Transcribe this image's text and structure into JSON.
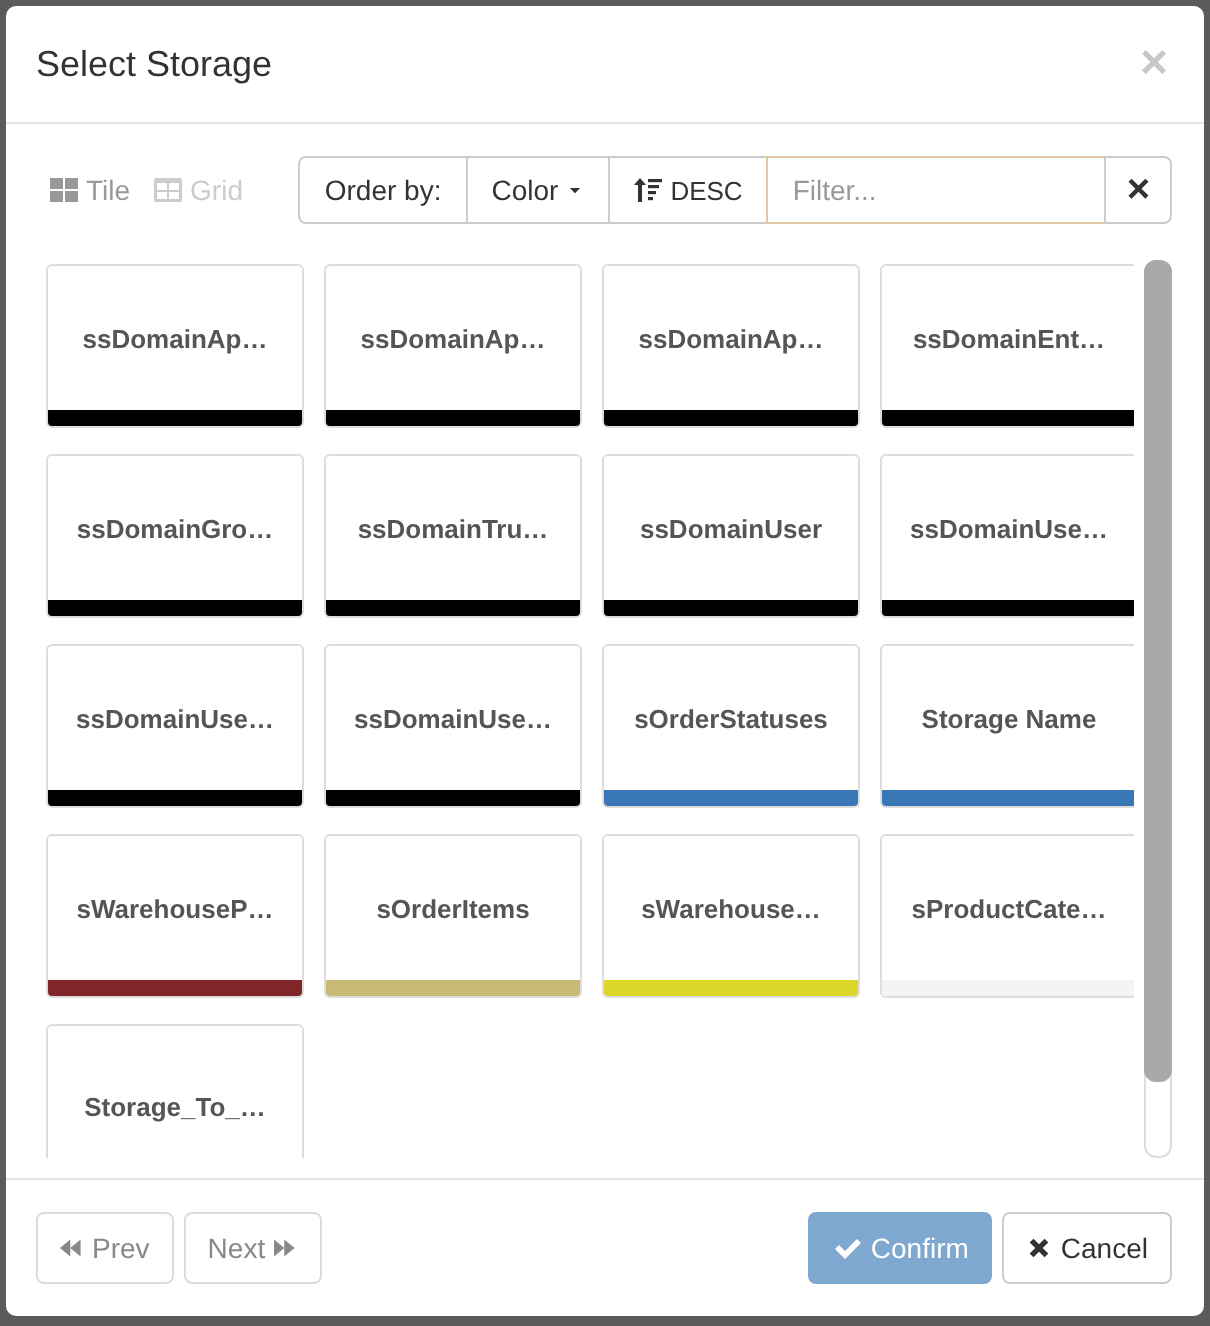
{
  "dialog": {
    "title": "Select Storage",
    "close": "×"
  },
  "toolbar": {
    "views": [
      {
        "label": "Tile",
        "selected": true
      },
      {
        "label": "Grid",
        "selected": false
      }
    ],
    "order_label": "Order by:",
    "order_field": "Color",
    "sort_direction": "DESC",
    "filter": {
      "placeholder": "Filter..."
    },
    "clear": "×"
  },
  "tiles": [
    {
      "name": "ssDomainAp…",
      "color": "#000000"
    },
    {
      "name": "ssDomainAp…",
      "color": "#000000"
    },
    {
      "name": "ssDomainAp…",
      "color": "#000000"
    },
    {
      "name": "ssDomainEnt…",
      "color": "#000000"
    },
    {
      "name": "ssDomainGro…",
      "color": "#000000"
    },
    {
      "name": "ssDomainTru…",
      "color": "#000000"
    },
    {
      "name": "ssDomainUser",
      "color": "#000000"
    },
    {
      "name": "ssDomainUse…",
      "color": "#000000"
    },
    {
      "name": "ssDomainUse…",
      "color": "#000000"
    },
    {
      "name": "ssDomainUse…",
      "color": "#000000"
    },
    {
      "name": "sOrderStatuses",
      "color": "#3a78b5"
    },
    {
      "name": "Storage Name",
      "color": "#3a78b5"
    },
    {
      "name": "sWarehouseP…",
      "color": "#802628"
    },
    {
      "name": "sOrderItems",
      "color": "#c8b977"
    },
    {
      "name": "sWarehouse…",
      "color": "#dcd62a"
    },
    {
      "name": "sProductCate…",
      "color": "#f4f4f4"
    },
    {
      "name": "Storage_To_…"
    }
  ],
  "footer": {
    "prev": {
      "label": "Prev",
      "disabled": true
    },
    "next": {
      "label": "Next",
      "disabled": true
    },
    "confirm": {
      "label": "Confirm",
      "disabled": true
    },
    "cancel": {
      "label": "Cancel",
      "disabled": false
    }
  }
}
